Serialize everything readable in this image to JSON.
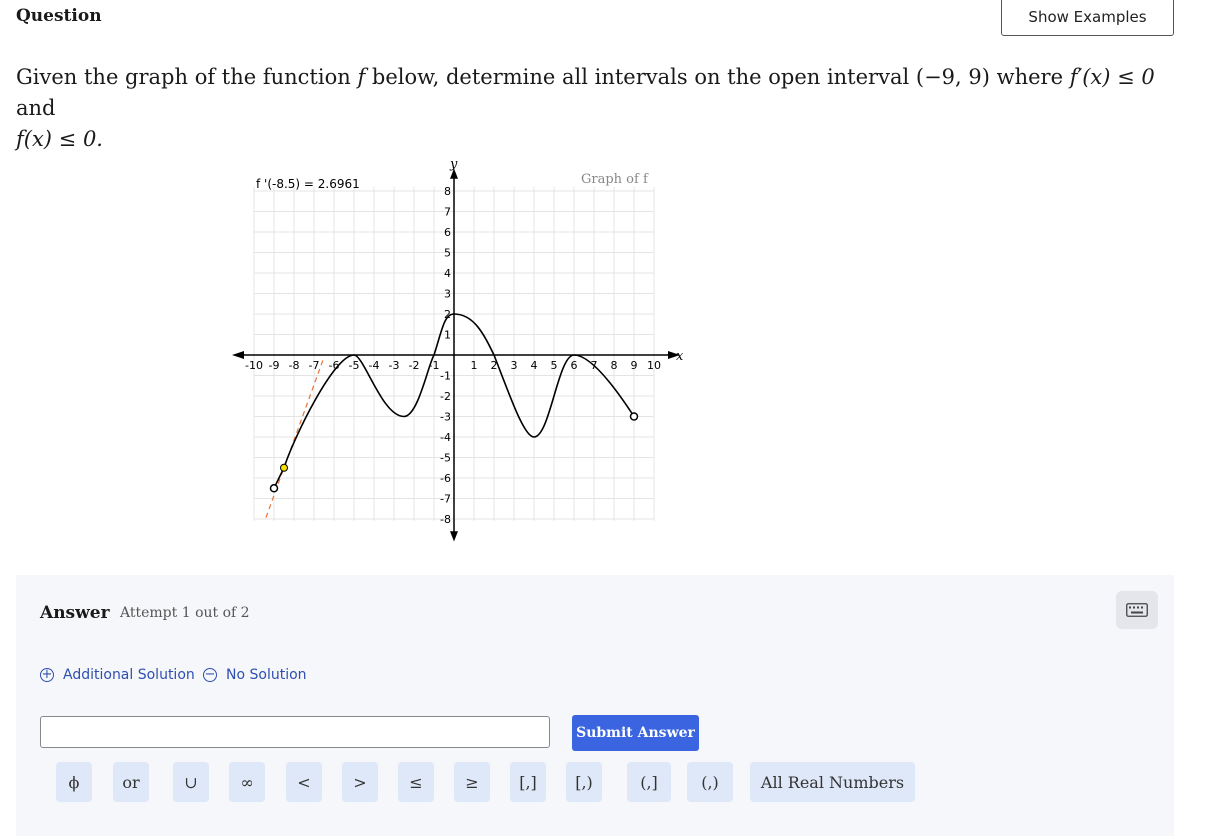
{
  "header": {
    "title": "Question",
    "show_examples": "Show Examples"
  },
  "prompt": {
    "text1": "Given the graph of the function ",
    "f": "f",
    "text2": " below, determine all intervals on the open interval ",
    "interval": "(−9, 9)",
    "text3": " where ",
    "cond1": "f′(x) ≤ 0",
    "text4": " and",
    "cond2": "f(x) ≤ 0."
  },
  "graph": {
    "tangent_label": "f '(-8.5) = 2.6961",
    "title": "Graph of f",
    "y_axis": "y",
    "x_axis": "x",
    "x_ticks": [
      "-10",
      "-9",
      "-8",
      "-7",
      "-6",
      "-5",
      "-4",
      "-3",
      "-2",
      "-1",
      "1",
      "2",
      "3",
      "4",
      "5",
      "6",
      "7",
      "8",
      "9",
      "10"
    ],
    "y_ticks": [
      "8",
      "7",
      "6",
      "5",
      "4",
      "3",
      "2",
      "1",
      "-1",
      "-2",
      "-3",
      "-4",
      "-5",
      "-6",
      "-7",
      "-8"
    ],
    "xlim": [
      -10,
      10
    ],
    "ylim": [
      -8,
      8
    ],
    "curve_color": "#000000",
    "tangent_color": "#e8743b",
    "point_color": "#f5e000"
  },
  "answer": {
    "label": "Answer",
    "attempt": "Attempt 1 out of 2",
    "additional_solution": "Additional Solution",
    "no_solution": "No Solution",
    "input_value": "",
    "submit": "Submit Answer",
    "symbols": [
      "ϕ",
      "or",
      "∪",
      "∞",
      "<",
      ">",
      "≤",
      "≥",
      "[,]",
      "[,)",
      "(,]",
      "(,)",
      "All Real Numbers"
    ]
  }
}
